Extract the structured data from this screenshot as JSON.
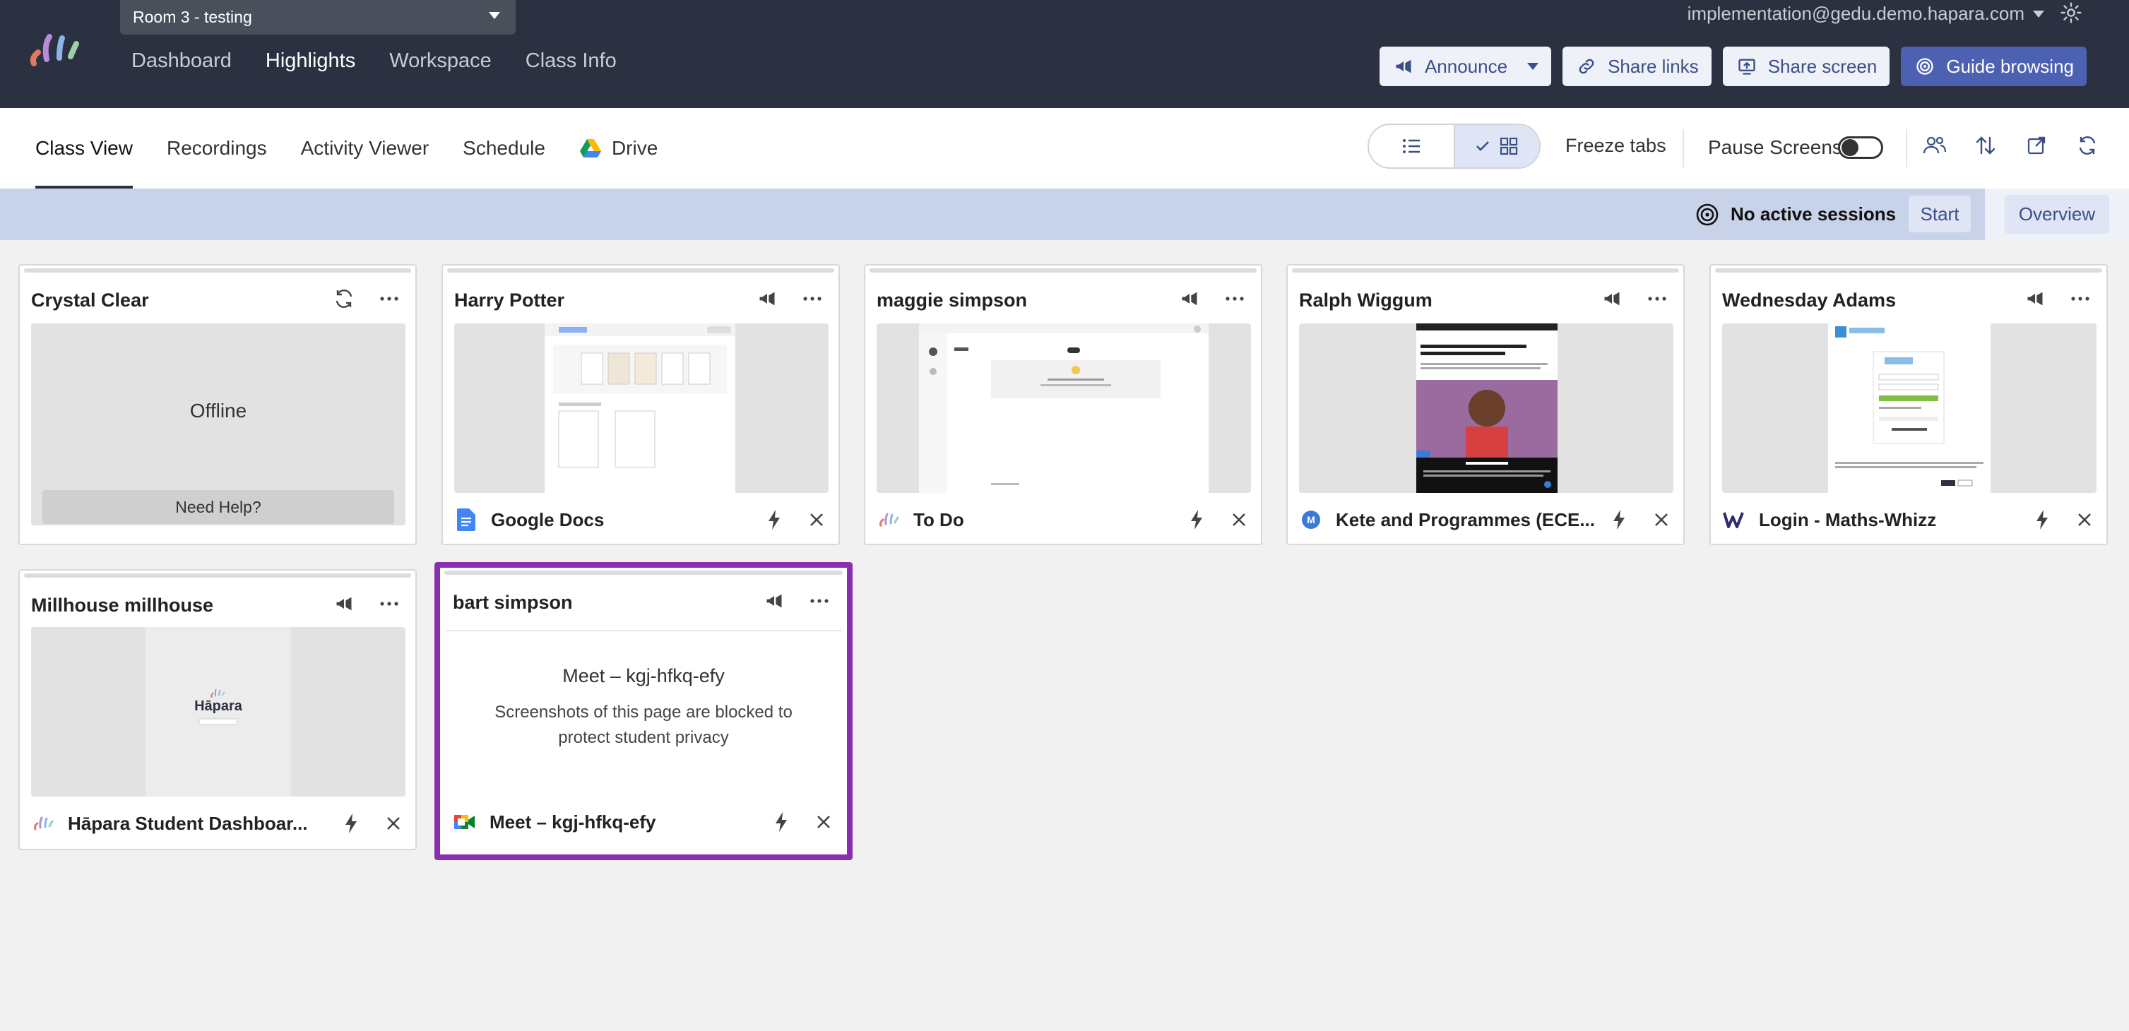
{
  "header": {
    "class_select": "Room 3 - testing",
    "user_email": "implementation@gedu.demo.hapara.com",
    "nav": [
      "Dashboard",
      "Highlights",
      "Workspace",
      "Class Info"
    ],
    "buttons": {
      "announce": "Announce",
      "share_links": "Share links",
      "share_screen": "Share screen",
      "guide_browsing": "Guide browsing"
    }
  },
  "subnav": {
    "tabs": [
      "Class View",
      "Recordings",
      "Activity Viewer",
      "Schedule",
      "Drive"
    ],
    "freeze_tabs": "Freeze tabs",
    "pause_screens": "Pause Screens"
  },
  "session": {
    "status": "No active sessions",
    "start": "Start",
    "overview": "Overview"
  },
  "students": [
    {
      "name": "Crystal Clear",
      "status": "Offline",
      "help": "Need Help?"
    },
    {
      "name": "Harry Potter",
      "tab_title": "Google Docs"
    },
    {
      "name": "maggie simpson",
      "tab_title": "To Do"
    },
    {
      "name": "Ralph Wiggum",
      "tab_title": "Kete and Programmes (ECE..."
    },
    {
      "name": "Wednesday Adams",
      "tab_title": "Login - Maths-Whizz"
    },
    {
      "name": "Millhouse millhouse",
      "tab_title": "Hāpara Student Dashboar..."
    },
    {
      "name": "bart simpson",
      "blocked_title": "Meet – kgj-hfkq-efy",
      "blocked_desc": "Screenshots of this page are blocked to protect student privacy",
      "tab_title": "Meet – kgj-hfkq-efy"
    }
  ],
  "thumbnail_text": {
    "hapara_logo": "Hāpara"
  },
  "colors": {
    "topbar": "#2b3140",
    "accent": "#4d61b3",
    "selected_border": "#8a2fb0",
    "session_bar": "#c8d2e8"
  }
}
